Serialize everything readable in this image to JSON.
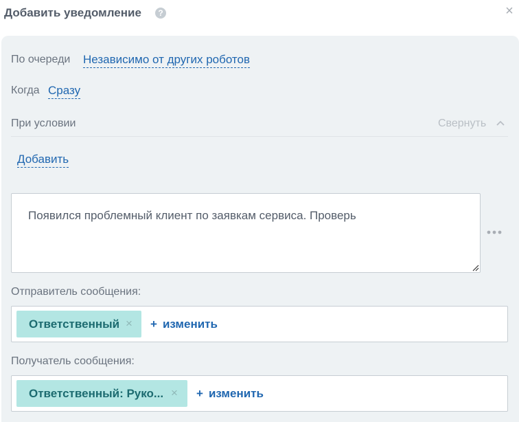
{
  "dialog": {
    "title": "Добавить уведомление",
    "help_icon": "?",
    "close_icon": "×"
  },
  "settings": {
    "queue_label": "По очереди",
    "queue_value": "Независимо от других роботов",
    "when_label": "Когда",
    "when_value": "Сразу",
    "condition_label": "При условии",
    "collapse_label": "Свернуть",
    "add_label": "Добавить"
  },
  "message": {
    "text": "Появился проблемный клиент по заявкам сервиса. Проверь"
  },
  "sender": {
    "label": "Отправитель сообщения:",
    "chip": "Ответственный",
    "change_label": "изменить"
  },
  "recipient": {
    "label": "Получатель сообщения:",
    "chip": "Ответственный: Руко...",
    "change_label": "изменить"
  },
  "colors": {
    "accent": "#2067b0",
    "chip_bg": "#b3e6e3",
    "chip_text": "#1c6b70",
    "panel_bg": "#eef2f4"
  }
}
